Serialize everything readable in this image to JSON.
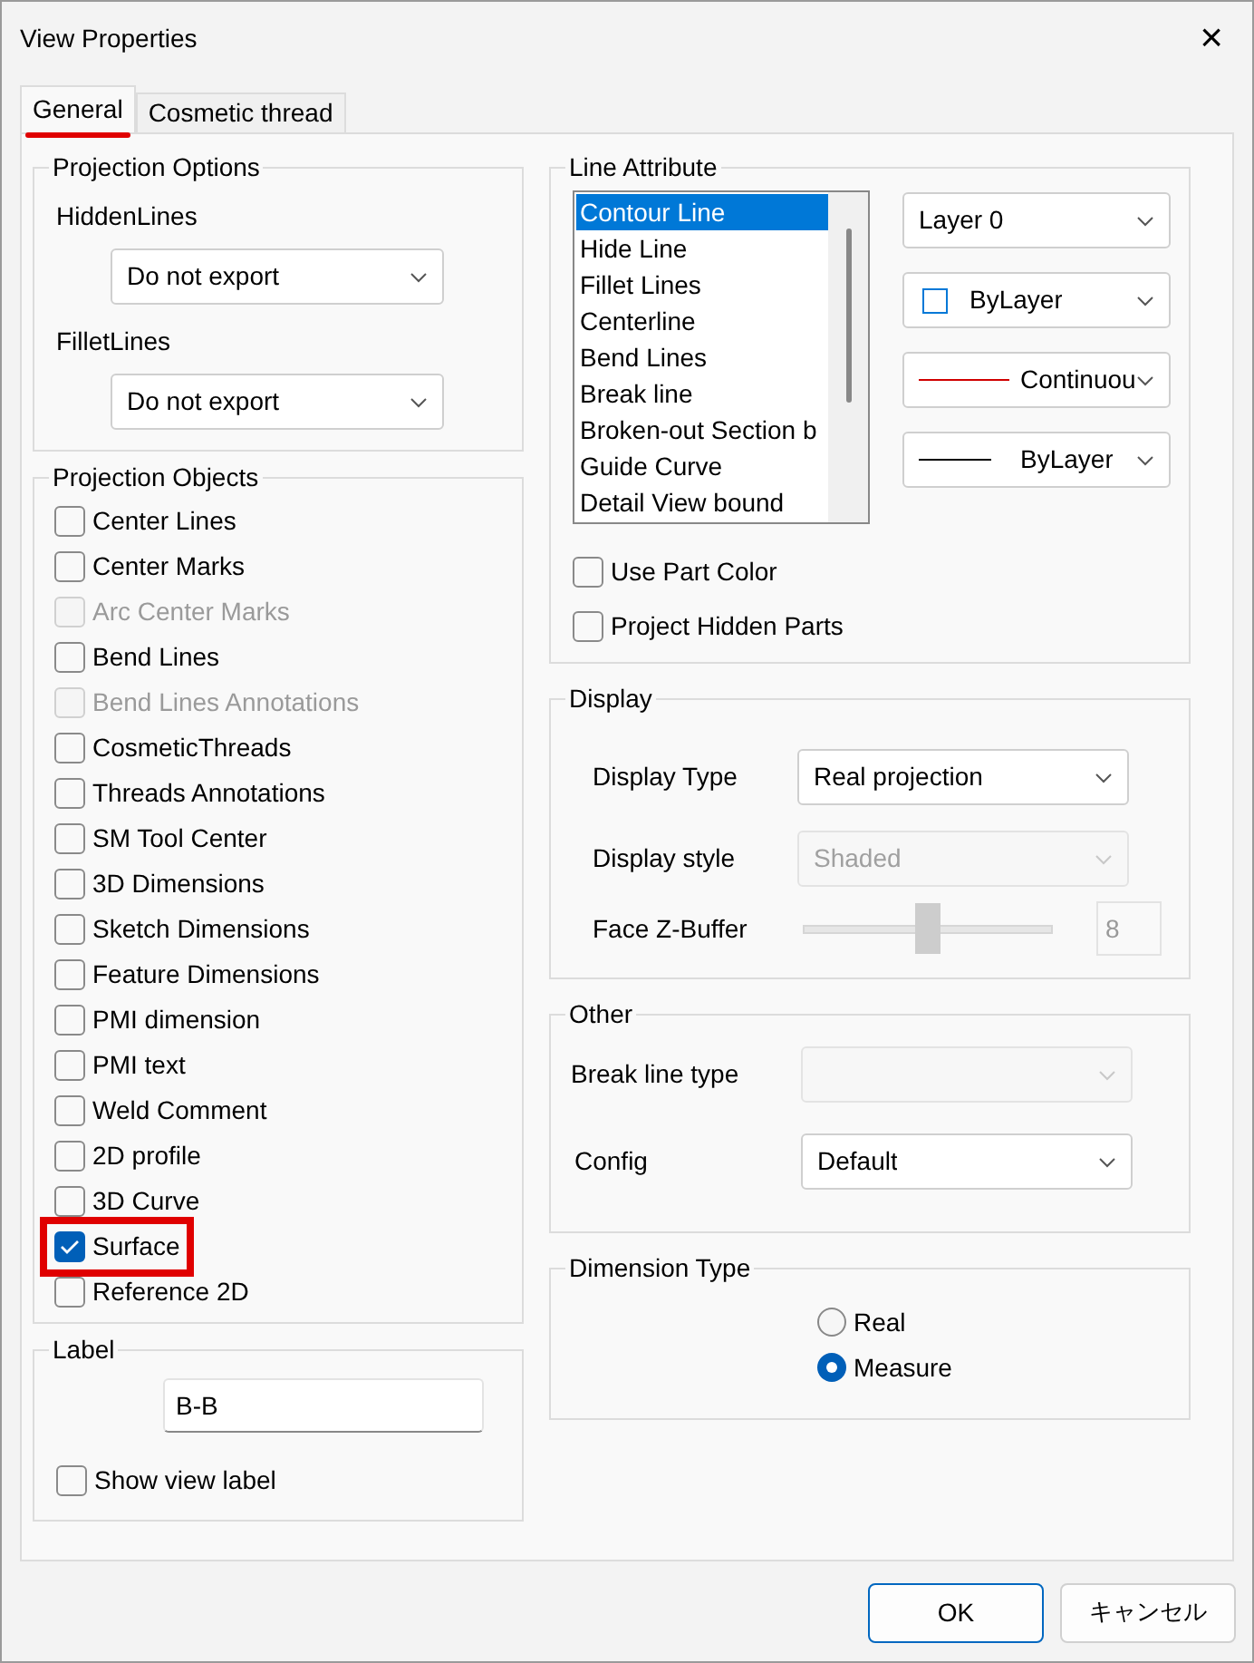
{
  "window": {
    "title": "View Properties",
    "close": "×"
  },
  "tabs": [
    {
      "label": "General",
      "selected": true,
      "highlighted": true
    },
    {
      "label": "Cosmetic thread",
      "selected": false,
      "highlighted": false
    }
  ],
  "projection_options": {
    "title": "Projection Options",
    "fields": [
      {
        "label": "HiddenLines",
        "value": "Do not export"
      },
      {
        "label": "FilletLines",
        "value": "Do not export"
      }
    ]
  },
  "projection_objects": {
    "title": "Projection Objects",
    "items": [
      {
        "label": "Center Lines",
        "checked": false,
        "disabled": false,
        "highlighted": false
      },
      {
        "label": "Center Marks",
        "checked": false,
        "disabled": false,
        "highlighted": false
      },
      {
        "label": "Arc Center Marks",
        "checked": false,
        "disabled": true,
        "highlighted": false
      },
      {
        "label": "Bend Lines",
        "checked": false,
        "disabled": false,
        "highlighted": false
      },
      {
        "label": "Bend Lines Annotations",
        "checked": false,
        "disabled": true,
        "highlighted": false
      },
      {
        "label": "CosmeticThreads",
        "checked": false,
        "disabled": false,
        "highlighted": false
      },
      {
        "label": "Threads Annotations",
        "checked": false,
        "disabled": false,
        "highlighted": false
      },
      {
        "label": "SM Tool Center",
        "checked": false,
        "disabled": false,
        "highlighted": false
      },
      {
        "label": "3D Dimensions",
        "checked": false,
        "disabled": false,
        "highlighted": false
      },
      {
        "label": "Sketch Dimensions",
        "checked": false,
        "disabled": false,
        "highlighted": false
      },
      {
        "label": "Feature Dimensions",
        "checked": false,
        "disabled": false,
        "highlighted": false
      },
      {
        "label": "PMI dimension",
        "checked": false,
        "disabled": false,
        "highlighted": false
      },
      {
        "label": "PMI text",
        "checked": false,
        "disabled": false,
        "highlighted": false
      },
      {
        "label": "Weld Comment",
        "checked": false,
        "disabled": false,
        "highlighted": false
      },
      {
        "label": "2D profile",
        "checked": false,
        "disabled": false,
        "highlighted": false
      },
      {
        "label": "3D Curve",
        "checked": false,
        "disabled": false,
        "highlighted": false
      },
      {
        "label": "Surface",
        "checked": true,
        "disabled": false,
        "highlighted": true
      },
      {
        "label": "Reference 2D",
        "checked": false,
        "disabled": false,
        "highlighted": false
      }
    ]
  },
  "label_group": {
    "title": "Label",
    "value": "B-B",
    "show_label": {
      "label": "Show view label",
      "checked": false
    }
  },
  "line_attribute": {
    "title": "Line Attribute",
    "list": [
      {
        "label": "Contour Line",
        "selected": true
      },
      {
        "label": "Hide Line",
        "selected": false
      },
      {
        "label": "Fillet Lines",
        "selected": false
      },
      {
        "label": "Centerline",
        "selected": false
      },
      {
        "label": "Bend Lines",
        "selected": false
      },
      {
        "label": "Break line",
        "selected": false
      },
      {
        "label": "Broken-out Section b",
        "selected": false
      },
      {
        "label": "Guide Curve",
        "selected": false
      },
      {
        "label": "Detail View bound",
        "selected": false
      }
    ],
    "selects": [
      {
        "kind": "plain",
        "value": "Layer 0"
      },
      {
        "kind": "swatch",
        "value": "ByLayer"
      },
      {
        "kind": "red-line",
        "value": "Continuou"
      },
      {
        "kind": "black-line",
        "value": "ByLayer"
      }
    ],
    "checks": [
      {
        "label": "Use Part Color",
        "checked": false
      },
      {
        "label": "Project Hidden Parts",
        "checked": false
      }
    ]
  },
  "display": {
    "title": "Display",
    "display_type": {
      "label": "Display Type",
      "value": "Real projection",
      "disabled": false
    },
    "display_style": {
      "label": "Display style",
      "value": "Shaded",
      "disabled": true
    },
    "z_buffer": {
      "label": "Face Z-Buffer",
      "level": 0.5,
      "value": "8",
      "disabled": true
    }
  },
  "other": {
    "title": "Other",
    "break_line_type": {
      "label": "Break line type",
      "disabled": true
    },
    "config": {
      "label": "Config",
      "value": "Default",
      "disabled": false
    }
  },
  "dimension_type": {
    "title": "Dimension Type",
    "options": [
      {
        "label": "Real",
        "selected": false
      },
      {
        "label": "Measure",
        "selected": true
      }
    ]
  },
  "buttons": [
    {
      "label": "OK",
      "kind": "primary"
    },
    {
      "label": "キャンセル",
      "kind": "secondary"
    }
  ]
}
